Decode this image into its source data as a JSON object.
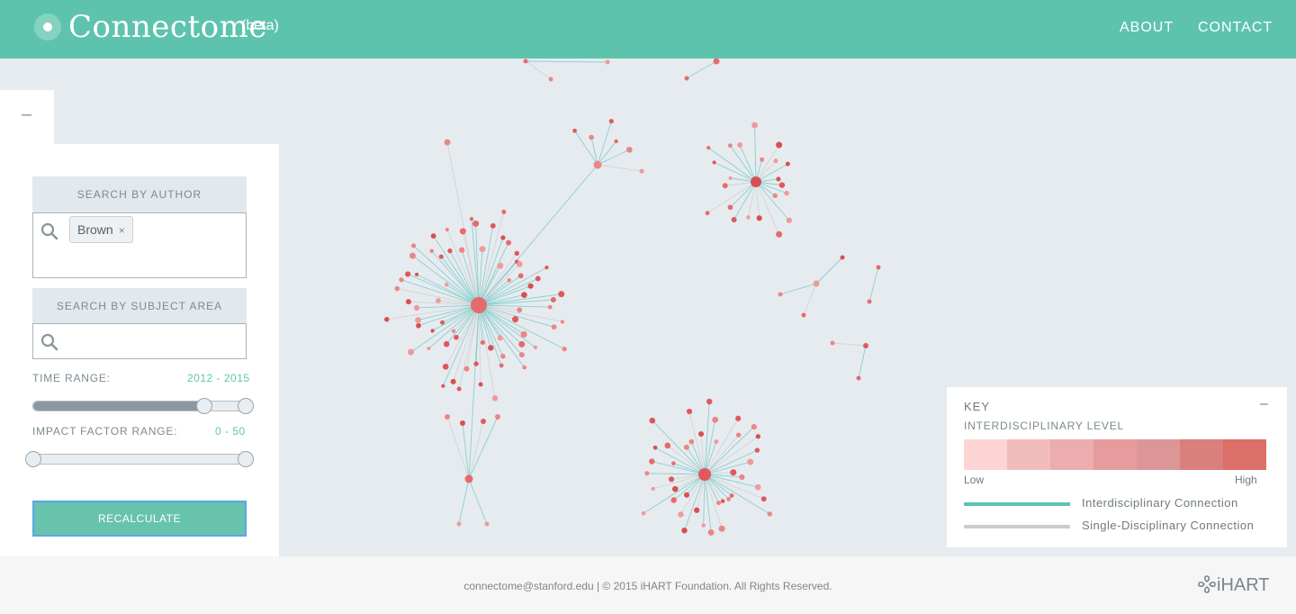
{
  "header": {
    "brand": "Connectome",
    "beta": "(beta)",
    "nav": {
      "about": "ABOUT",
      "contact": "CONTACT"
    }
  },
  "sidebar": {
    "collapse_symbol": "–",
    "author": {
      "heading": "SEARCH BY AUTHOR",
      "tags": [
        "Brown"
      ],
      "tag_remove": "×"
    },
    "subject": {
      "heading": "SEARCH BY SUBJECT AREA",
      "value": ""
    },
    "time": {
      "label": "TIME RANGE:",
      "value": "2012 - 2015",
      "fill_fraction": 0.8
    },
    "impact": {
      "label": "IMPACT FACTOR RANGE:",
      "value": "0 - 50"
    },
    "button_label": "RECALCULATE"
  },
  "key": {
    "title": "KEY",
    "collapse": "–",
    "subtitle": "INTERDISCIPLINARY LEVEL",
    "scale_colors": [
      "#fdd4d4",
      "#f2bcbc",
      "#ebadad",
      "#e69c9c",
      "#dc9698",
      "#d97f7d",
      "#dc6f67"
    ],
    "low": "Low",
    "high": "High",
    "interdisciplinary": {
      "label": "Interdisciplinary Connection",
      "color": "#5ec3ad"
    },
    "single": {
      "label": "Single-Disciplinary Connection",
      "color": "#c8ccd0"
    }
  },
  "footer": {
    "text": "connectome@stanford.edu | © 2015 iHART Foundation. All Rights Reserved.",
    "logo": "iHART"
  },
  "colors": {
    "accent": "#5ec3ad",
    "node": "#e0585c",
    "edge_inter": "#8ad0cd",
    "edge_single": "#d4d4d4"
  }
}
